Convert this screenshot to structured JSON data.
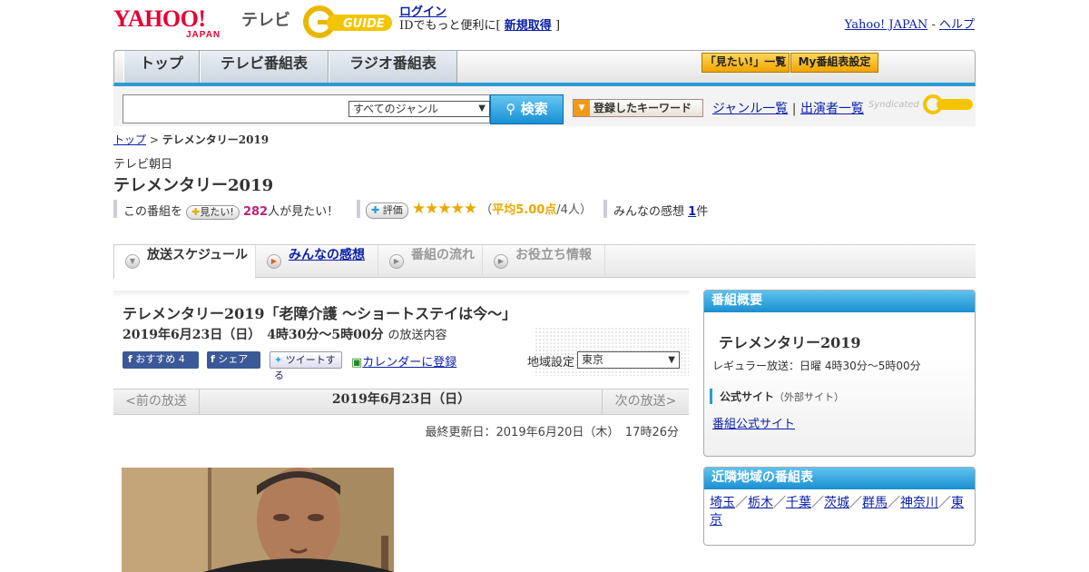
{
  "header": {
    "logo_text": "YAHOO!",
    "logo_sub": "JAPAN",
    "tv_label": "テレビ",
    "gguide_logo": "GUIDE",
    "login_label": "ログイン",
    "login_prompt": "IDでもっと便利に[",
    "signup_label": "新規取得",
    "login_prompt_end": "]",
    "yahoo_japan_link": "Yahoo! JAPAN",
    "separator": "-",
    "help_link": "ヘルプ"
  },
  "nav": {
    "tabs": [
      "トップ",
      "テレビ番組表",
      "ラジオ番組表"
    ],
    "mitai_list_btn": "「見たい!」一覧",
    "my_schedule_btn": "My番組表設定"
  },
  "search": {
    "input_value": "",
    "genre_selected": "すべてのジャンル",
    "search_btn": "検索",
    "keyword_btn": "登録したキーワード",
    "genre_list_link": "ジャンル一覧",
    "link_separator": "|",
    "performer_list_link": "出演者一覧",
    "syndicated": "Syndicated"
  },
  "breadcrumb": {
    "top": "トップ",
    "sep": ">",
    "current": "テレメンタリー2019"
  },
  "program": {
    "station": "テレビ朝日",
    "title": "テレメンタリー2019",
    "mitai_prefix": "この番組を",
    "mitai_pill": "見たい!",
    "mitai_count": "282",
    "mitai_suffix": "人が見たい！",
    "rating_pill": "評価",
    "stars": "★★★★★",
    "rating_avg_open": "（",
    "rating_avg": "平均5.00点",
    "rating_count": "/4人）",
    "reviews_label": "みんなの感想",
    "reviews_count": "1",
    "reviews_unit": "件"
  },
  "tabs": {
    "schedule": "放送スケジュール",
    "reviews": "みんなの感想",
    "flow": "番組の流れ",
    "info": "お役立ち情報"
  },
  "episode": {
    "title": "テレメンタリー2019「老障介護 ～ショートステイは今～」",
    "datetime": "2019年6月23日（日）　4時30分～5時00分",
    "datetime_suffix": "の放送内容",
    "fb_recommend": "おすすめ 4",
    "fb_share": "シェア",
    "tweet": "ツイートする",
    "calendar": "カレンダーに登録",
    "area_label": "地域設定",
    "area_selected": "東京"
  },
  "pager": {
    "prev": "<前の放送",
    "current": "2019年6月23日（日）",
    "next": "次の放送>"
  },
  "updated": "最終更新日：2019年6月20日（木）　17時26分",
  "sidebar": {
    "overview_head": "番組概要",
    "overview_title": "テレメンタリー2019",
    "regular": "レギュラー放送：日曜 4時30分～5時00分",
    "official_site_label": "公式サイト",
    "official_site_ext": "（外部サイト）",
    "official_site_link": "番組公式サイト",
    "nearby_head": "近隣地域の番組表",
    "nearby": [
      "埼玉",
      "栃木",
      "千葉",
      "茨城",
      "群馬",
      "神奈川",
      "東京"
    ],
    "nearby_sep": "／"
  },
  "colors": {
    "accent_blue": "#2b9ad6",
    "yahoo_red": "#e60033",
    "star": "#e8a800",
    "count_pink": "#c0207a"
  }
}
